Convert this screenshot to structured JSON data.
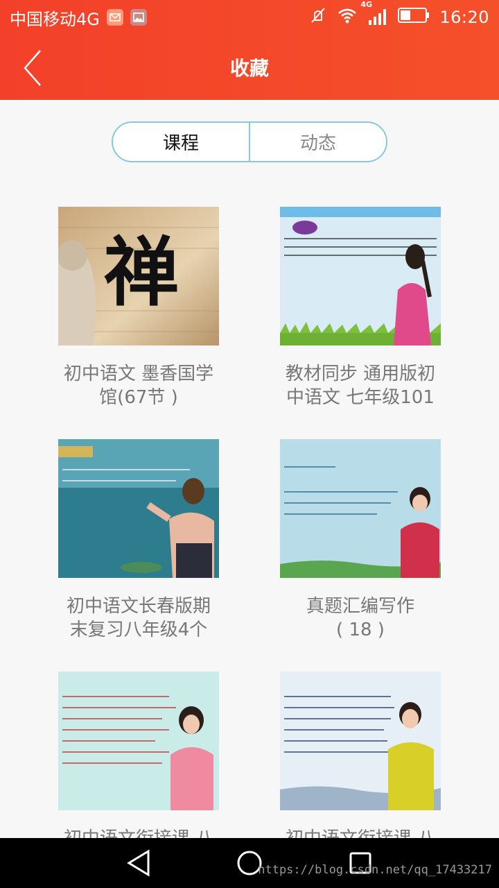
{
  "status_bar": {
    "carrier": "中国移动4G",
    "network_badge": "4G",
    "time": "16:20",
    "icons": [
      "mail-notification-icon",
      "image-notification-icon",
      "mute-icon",
      "wifi-icon",
      "signal-icon",
      "battery-icon"
    ]
  },
  "header": {
    "title": "收藏",
    "back_icon": "chevron-left-icon"
  },
  "segment": {
    "tabs": [
      {
        "label": "课程",
        "active": true
      },
      {
        "label": "动态",
        "active": false
      }
    ]
  },
  "courses": [
    {
      "line1": "初中语文 墨香国学",
      "line2": "馆(67节 )"
    },
    {
      "line1": "教材同步 通用版初",
      "line2": "中语文 七年级101"
    },
    {
      "line1": "初中语文长春版期",
      "line2": "末复习八年级4个"
    },
    {
      "line1": "真题汇编写作",
      "line2": "( 18 )"
    },
    {
      "line1": "初中语文衔接课 八",
      "line2": ""
    },
    {
      "line1": "初中语文衔接课 八",
      "line2": ""
    }
  ],
  "nav": {
    "icons": [
      "back-triangle-icon",
      "home-circle-icon",
      "recents-square-icon"
    ]
  },
  "watermark": "https://blog.csdn.net/qq_17433217",
  "colors": {
    "accent": "#f3402a",
    "segment_border": "#84cbe0"
  }
}
